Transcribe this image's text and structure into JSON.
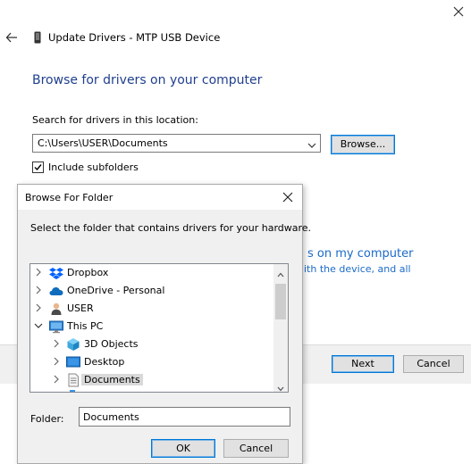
{
  "wizard": {
    "title": "Update Drivers - MTP USB Device",
    "heading": "Browse for drivers on your computer",
    "search_label": "Search for drivers in this location:",
    "path_value": "C:\\Users\\USER\\Documents",
    "browse_label": "Browse...",
    "include_subfolders_label": "Include subfolders",
    "include_subfolders_checked": true,
    "link_fragment": "s on my computer",
    "desc_fragment": "ith the device, and all",
    "next_label": "Next",
    "cancel_label": "Cancel"
  },
  "dialog": {
    "title": "Browse For Folder",
    "instruction": "Select the folder that contains drivers for your hardware.",
    "tree": [
      {
        "label": "Dropbox",
        "icon": "dropbox-icon",
        "expander": "collapsed",
        "level": 0
      },
      {
        "label": "OneDrive - Personal",
        "icon": "onedrive-cloud-icon",
        "expander": "collapsed",
        "level": 0
      },
      {
        "label": "USER",
        "icon": "user-folder-icon",
        "expander": "collapsed",
        "level": 0
      },
      {
        "label": "This PC",
        "icon": "computer-icon",
        "expander": "expanded",
        "level": 0
      },
      {
        "label": "3D Objects",
        "icon": "3d-objects-icon",
        "expander": "collapsed",
        "level": 1
      },
      {
        "label": "Desktop",
        "icon": "desktop-icon",
        "expander": "collapsed",
        "level": 1
      },
      {
        "label": "Documents",
        "icon": "documents-icon",
        "expander": "collapsed",
        "level": 1,
        "selected": true
      }
    ],
    "folder_label": "Folder:",
    "folder_value": "Documents",
    "ok_label": "OK",
    "cancel_label": "Cancel"
  },
  "colors": {
    "heading": "#1f3f8e",
    "link": "#1b6ac9",
    "focus_border": "#0078d7"
  }
}
